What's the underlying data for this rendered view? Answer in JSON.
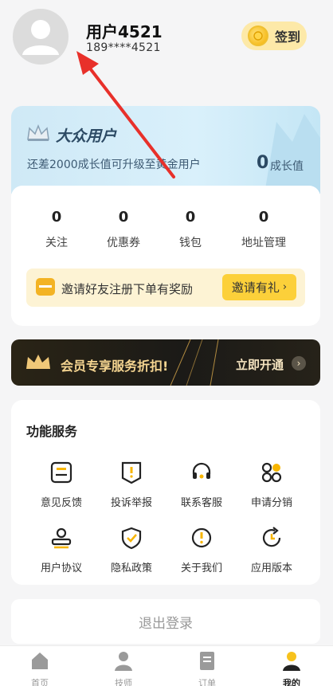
{
  "user": {
    "name": "用户4521",
    "phone": "189****4521",
    "signin_label": "签到"
  },
  "membership": {
    "level": "大众用户",
    "description": "还差2000成长值可升级至黄金用户",
    "growth_value": "0",
    "growth_label": "成长值"
  },
  "stats": [
    {
      "value": "0",
      "label": "关注"
    },
    {
      "value": "0",
      "label": "优惠券"
    },
    {
      "value": "0",
      "label": "钱包"
    },
    {
      "value": "0",
      "label": "地址管理"
    }
  ],
  "invite": {
    "text": "邀请好友注册下单有奖励",
    "button": "邀请有礼",
    "button_icon": "chevron-right-icon"
  },
  "vip": {
    "text": "会员专享服务折扣!",
    "action": "立即开通",
    "action_icon": "chevron-right-icon"
  },
  "services": {
    "title": "功能服务",
    "items": [
      {
        "label": "意见反馈",
        "icon": "feedback-icon"
      },
      {
        "label": "投诉举报",
        "icon": "report-icon"
      },
      {
        "label": "联系客服",
        "icon": "headset-icon"
      },
      {
        "label": "申请分销",
        "icon": "grid-apps-icon"
      },
      {
        "label": "用户协议",
        "icon": "stamp-icon"
      },
      {
        "label": "隐私政策",
        "icon": "shield-check-icon"
      },
      {
        "label": "关于我们",
        "icon": "info-icon"
      },
      {
        "label": "应用版本",
        "icon": "refresh-icon"
      }
    ]
  },
  "logout_label": "退出登录",
  "tabs": [
    {
      "label": "首页",
      "icon": "home-icon",
      "active": false
    },
    {
      "label": "技师",
      "icon": "technician-icon",
      "active": false
    },
    {
      "label": "订单",
      "icon": "order-icon",
      "active": false
    },
    {
      "label": "我的",
      "icon": "profile-icon",
      "active": true
    }
  ],
  "colors": {
    "accent_yellow": "#fcd03a",
    "member_card": "#d9f0fb",
    "vip_banner": "#1b1a17",
    "vip_gold": "#f5d591",
    "annotation_arrow": "#e8302a"
  }
}
